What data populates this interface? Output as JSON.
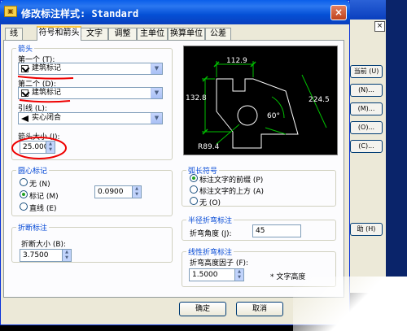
{
  "window": {
    "title": "修改标注样式: Standard",
    "close_label": "×"
  },
  "tabs": [
    {
      "label": "线"
    },
    {
      "label": "符号和箭头"
    },
    {
      "label": "文字"
    },
    {
      "label": "调整"
    },
    {
      "label": "主单位"
    },
    {
      "label": "换算单位"
    },
    {
      "label": "公差"
    }
  ],
  "arrowheads": {
    "group_label": "箭头",
    "first_label": "第一个 (T):",
    "first_value": "建筑标记",
    "second_label": "第二个 (D):",
    "second_value": "建筑标记",
    "leader_label": "引线 (L):",
    "leader_value": "实心闭合",
    "size_label": "箭头大小 (I):",
    "size_value": "25.0000"
  },
  "center_marks": {
    "group_label": "圆心标记",
    "options": [
      "无 (N)",
      "标记 (M)",
      "直线 (E)"
    ],
    "selected": 1,
    "value": "0.0900"
  },
  "break": {
    "group_label": "折断标注",
    "size_label": "折断大小 (B):",
    "size_value": "3.7500"
  },
  "arc_length": {
    "group_label": "弧长符号",
    "options": [
      "标注文字的前缀 (P)",
      "标注文字的上方 (A)",
      "无 (O)"
    ],
    "selected": 0
  },
  "radius_jog": {
    "group_label": "半径折弯标注",
    "angle_label": "折弯角度 (J):",
    "angle_value": "45"
  },
  "linear_jog": {
    "group_label": "线性折弯标注",
    "factor_label": "折弯高度因子 (F):",
    "factor_value": "1.5000",
    "suffix": "* 文字高度"
  },
  "preview": {
    "dims": [
      "112.9",
      "132.8",
      "224.5",
      "60°",
      "R89.4"
    ]
  },
  "buttons": {
    "ok": "确定",
    "cancel": "取消"
  },
  "background_window": {
    "buttons": [
      "当前 (U)",
      "(N)...",
      "(M)...",
      "(O)...",
      "(C)...",
      "助 (H)"
    ]
  }
}
